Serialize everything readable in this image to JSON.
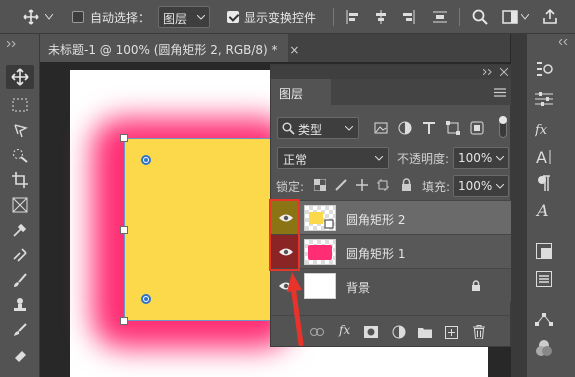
{
  "options_bar": {
    "auto_select_label": "自动选择：",
    "auto_select_target": "图层",
    "show_transform_label": "显示变换控件"
  },
  "document_tab": {
    "title": "未标题-1 @ 100% (圆角矩形 2, RGB/8) *",
    "close": "×"
  },
  "layers_panel": {
    "tab_label": "图层",
    "filter_kind": "类型",
    "blend_mode": "正常",
    "opacity_label": "不透明度:",
    "opacity_value": "100%",
    "lock_label": "锁定:",
    "fill_label": "填充:",
    "fill_value": "100%",
    "layers": [
      {
        "name": "圆角矩形 2",
        "selected": true,
        "thumb": "yellow-shape"
      },
      {
        "name": "圆角矩形 1",
        "selected": false,
        "thumb": "pink-shape"
      },
      {
        "name": "背景",
        "selected": false,
        "thumb": "white",
        "locked": true
      }
    ],
    "footer_fx": "fx"
  },
  "colors": {
    "yellow": "#fcd94a",
    "pink": "#ff2e74",
    "annotation_red": "#e8332b",
    "panel_bg": "#535353"
  }
}
